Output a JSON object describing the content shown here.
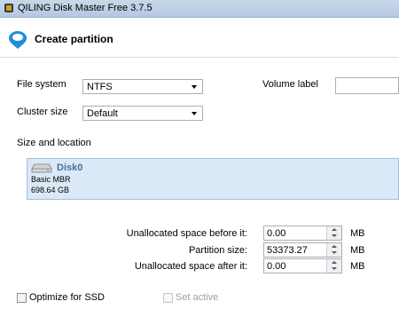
{
  "window": {
    "title": "QILING Disk Master Free 3.7.5"
  },
  "header": {
    "title": "Create partition"
  },
  "form": {
    "file_system_label": "File system",
    "file_system_value": "NTFS",
    "volume_label_label": "Volume label",
    "volume_label_value": "",
    "cluster_size_label": "Cluster size",
    "cluster_size_value": "Default",
    "size_location_label": "Size and location"
  },
  "disk": {
    "name": "Disk0",
    "type": "Basic MBR",
    "size": "698.64 GB"
  },
  "sizes": {
    "before_label": "Unallocated space before it:",
    "before_value": "0.00",
    "partition_label": "Partition size:",
    "partition_value": "53373.27",
    "after_label": "Unallocated space after it:",
    "after_value": "0.00",
    "unit": "MB"
  },
  "options": {
    "optimize_ssd_label": "Optimize for SSD",
    "set_active_label": "Set active"
  },
  "icons": {
    "app": "disk-app-icon",
    "header": "partition-icon",
    "disk": "hard-drive-icon"
  },
  "colors": {
    "accent": "#1e8fd6",
    "disk_panel": "#dbe8f7",
    "disk_name": "#4a6fa5"
  }
}
